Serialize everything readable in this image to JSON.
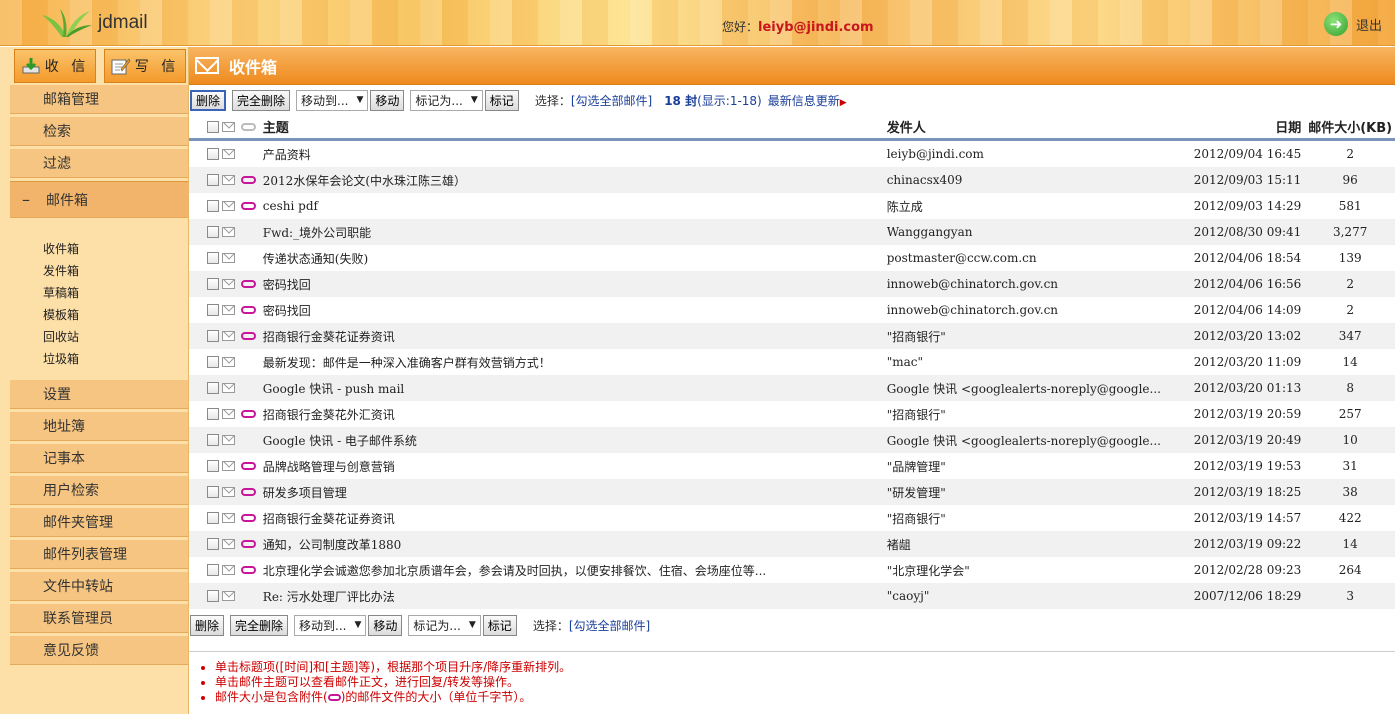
{
  "header": {
    "app_name": "jdmail",
    "greeting": "您好：",
    "user": "leiyb@jindi.com",
    "logout_label": "退出"
  },
  "sidebar": {
    "receive_label": "收 信",
    "compose_label": "写 信",
    "menu_top": [
      "邮箱管理",
      "检索",
      "过滤"
    ],
    "mailbox_label": "邮件箱",
    "folders": [
      "收件箱",
      "发件箱",
      "草稿箱",
      "模板箱",
      "回收站",
      "垃圾箱"
    ],
    "menu_bottom": [
      "设置",
      "地址簿",
      "记事本",
      "用户检索",
      "邮件夹管理",
      "邮件列表管理",
      "文件中转站",
      "联系管理员",
      "意见反馈"
    ]
  },
  "main": {
    "title": "收件箱",
    "toolbar": {
      "delete": "删除",
      "delete_all": "完全删除",
      "move_select": "移动到...",
      "move": "移动",
      "mark_select": "标记为...",
      "mark": "标记",
      "select_label": "选择：",
      "select_all": "[勾选全部邮件]",
      "count": "18 封",
      "range": "(显示:1-18)",
      "newest": "最新信息更新"
    },
    "columns": {
      "subject": "主题",
      "from": "发件人",
      "date": "日期",
      "size": "邮件大小(KB)"
    },
    "rows": [
      {
        "att": false,
        "subject": "产品资料",
        "from": "leiyb@jindi.com",
        "date": "2012/09/04 16:45",
        "size": "2"
      },
      {
        "att": true,
        "subject": "2012水保年会论文(中水珠江陈三雄）",
        "from": "chinacsx409",
        "date": "2012/09/03 15:11",
        "size": "96"
      },
      {
        "att": true,
        "subject": "ceshi pdf",
        "from": "陈立成",
        "date": "2012/09/03 14:29",
        "size": "581"
      },
      {
        "att": false,
        "subject": "Fwd:_境外公司职能",
        "from": "Wanggangyan",
        "date": "2012/08/30 09:41",
        "size": "3,277"
      },
      {
        "att": false,
        "subject": "传递状态通知(失败)",
        "from": "postmaster@ccw.com.cn",
        "date": "2012/04/06 18:54",
        "size": "139"
      },
      {
        "att": true,
        "subject": "密码找回",
        "from": "innoweb@chinatorch.gov.cn",
        "date": "2012/04/06 16:56",
        "size": "2"
      },
      {
        "att": true,
        "subject": "密码找回",
        "from": "innoweb@chinatorch.gov.cn",
        "date": "2012/04/06 14:09",
        "size": "2"
      },
      {
        "att": true,
        "subject": "招商银行金葵花证券资讯",
        "from": "\"招商银行\"",
        "date": "2012/03/20 13:02",
        "size": "347"
      },
      {
        "att": false,
        "subject": "最新发现：邮件是一种深入准确客户群有效营销方式！",
        "from": "\"mac\"",
        "date": "2012/03/20 11:09",
        "size": "14"
      },
      {
        "att": false,
        "subject": "Google 快讯 - push mail",
        "from": "Google 快讯 <googlealerts-noreply@google...",
        "date": "2012/03/20 01:13",
        "size": "8"
      },
      {
        "att": true,
        "subject": "招商银行金葵花外汇资讯",
        "from": "\"招商银行\"",
        "date": "2012/03/19 20:59",
        "size": "257"
      },
      {
        "att": false,
        "subject": "Google 快讯 - 电子邮件系统",
        "from": "Google 快讯 <googlealerts-noreply@google...",
        "date": "2012/03/19 20:49",
        "size": "10"
      },
      {
        "att": true,
        "subject": "品牌战略管理与创意营销",
        "from": "\"品牌管理\"",
        "date": "2012/03/19 19:53",
        "size": "31"
      },
      {
        "att": true,
        "subject": "研发多项目管理",
        "from": "\"研发管理\"",
        "date": "2012/03/19 18:25",
        "size": "38"
      },
      {
        "att": true,
        "subject": "招商银行金葵花证券资讯",
        "from": "\"招商银行\"",
        "date": "2012/03/19 14:57",
        "size": "422"
      },
      {
        "att": true,
        "subject": "通知，公司制度改革1880",
        "from": "褚龃",
        "date": "2012/03/19 09:22",
        "size": "14"
      },
      {
        "att": true,
        "subject": "北京理化学会诚邀您参加北京质谱年会，参会请及时回执，以便安排餐饮、住宿、会场座位等...",
        "from": "\"北京理化学会\"",
        "date": "2012/02/28 09:23",
        "size": "264"
      },
      {
        "att": false,
        "subject": "Re: 污水处理厂评比办法",
        "from": "\"caoyj\"",
        "date": "2007/12/06 18:29",
        "size": "3"
      }
    ],
    "notes": [
      "单击标题项([时间]和[主题]等)，根据那个项目升序/降序重新排列。",
      "单击邮件主题可以查看邮件正文，进行回复/转发等操作。",
      "邮件大小是包含附件",
      "的邮件文件的大小（单位千字节）。"
    ]
  },
  "colors": {
    "accent": "#ee8a1e",
    "sidebar": "#fddfa8",
    "link": "#1a3f9a",
    "note": "#cc0000",
    "attachment": "#c8169a"
  }
}
